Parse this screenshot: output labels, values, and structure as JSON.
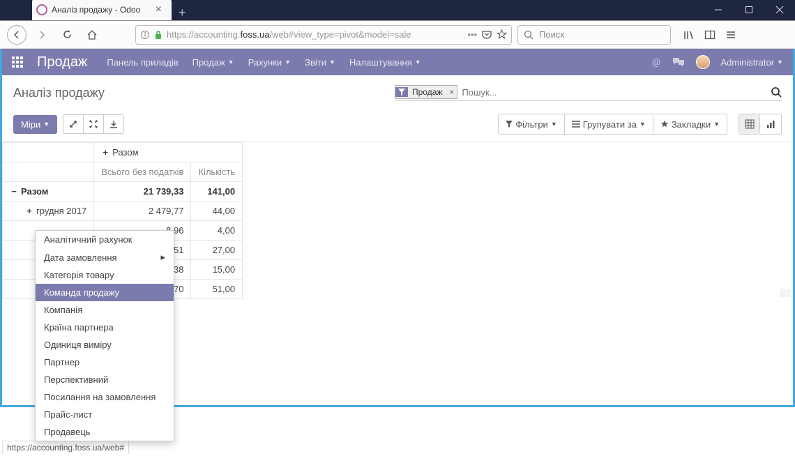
{
  "window": {
    "tab_title": "Аналіз продажу - Odoo"
  },
  "browser": {
    "url_dim_pre": "https://accounting.",
    "url_dark": "foss.ua",
    "url_dim_post": "/web#view_type=pivot&model=sale",
    "search_placeholder": "Поиск"
  },
  "odoo_menu": {
    "brand": "Продаж",
    "items": [
      "Панель приладів",
      "Продаж",
      "Рахунки",
      "Звіти",
      "Налаштування"
    ],
    "user": "Administrator"
  },
  "page": {
    "title": "Аналіз продажу",
    "search_tag": "Продаж",
    "search_placeholder": "Пошук..."
  },
  "buttons": {
    "measures": "Міри",
    "filters": "Фільтри",
    "groupby": "Групувати за",
    "favorites": "Закладки"
  },
  "pivot": {
    "col_total": "Разом",
    "measure_1": "Всього без податків",
    "measure_2": "Кількість",
    "row_total": "Разом",
    "total_val_1": "21 739,33",
    "total_val_2": "141,00",
    "rows": [
      {
        "label": "грудня 2017",
        "v1": "2 479,77",
        "v2": "44,00",
        "sign": "+"
      },
      {
        "label": "",
        "v1": "8,96",
        "v2": "4,00",
        "sign": ""
      },
      {
        "label": "",
        "v1": "3,51",
        "v2": "27,00",
        "sign": ""
      },
      {
        "label": "",
        "v1": "9,38",
        "v2": "15,00",
        "sign": ""
      },
      {
        "label": "",
        "v1": "7,70",
        "v2": "51,00",
        "sign": ""
      }
    ]
  },
  "dropdown": {
    "items": [
      "Аналітичний рахунок",
      "Дата замовлення",
      "Категорія товару",
      "Команда продажу",
      "Компанія",
      "Країна партнера",
      "Одиниця виміру",
      "Партнер",
      "Перспективний",
      "Посилання на замовлення",
      "Прайс-лист",
      "Продавець"
    ],
    "highlight_index": 3,
    "submenu_index": 1
  },
  "statusbar": "https://accounting.foss.ua/web#"
}
